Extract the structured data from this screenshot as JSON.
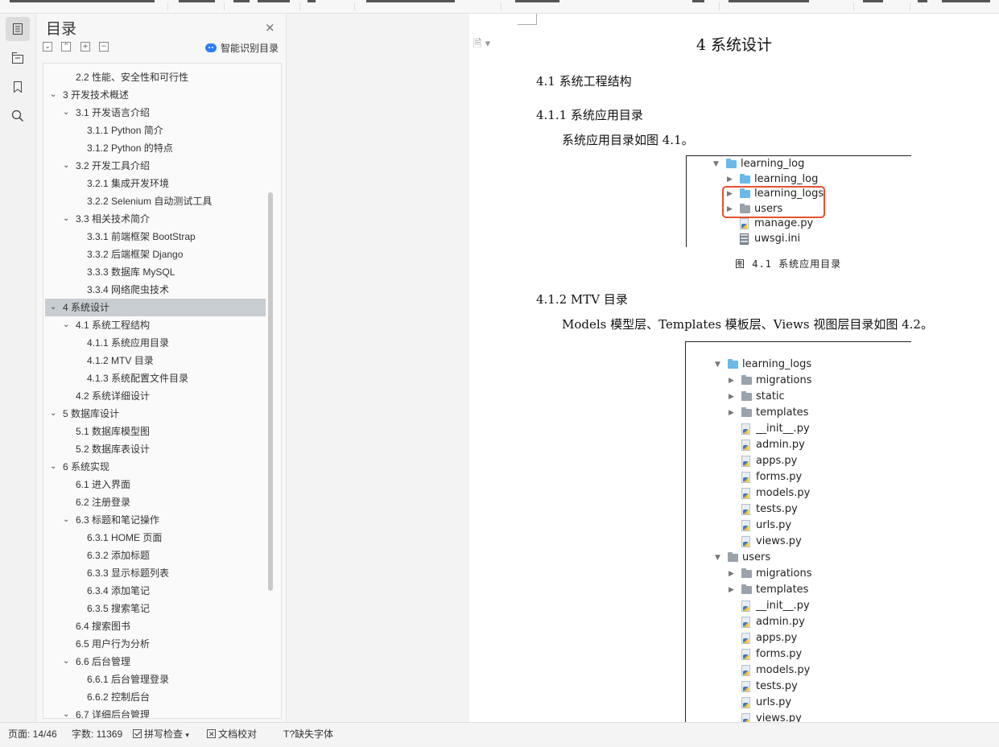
{
  "sidebar_rail": {
    "icons": [
      "toc-icon",
      "nav-pane-icon",
      "bookmark-icon",
      "search-icon"
    ]
  },
  "toc": {
    "title": "目录",
    "close_glyph": "×",
    "tools": [
      "⌄",
      "⌃",
      "+",
      "−"
    ],
    "smart_label": "智能识别目录",
    "items": [
      {
        "label": "2.2  性能、安全性和可行性",
        "level": 2,
        "expand": ""
      },
      {
        "label": "3 开发技术概述",
        "level": 1,
        "expand": "⌄"
      },
      {
        "label": "3.1  开发语言介绍",
        "level": 2,
        "expand": "⌄"
      },
      {
        "label": "3.1.1 Python 简介",
        "level": 3,
        "expand": ""
      },
      {
        "label": "3.1.2 Python 的特点",
        "level": 3,
        "expand": ""
      },
      {
        "label": "3.2  开发工具介绍",
        "level": 2,
        "expand": "⌄"
      },
      {
        "label": "3.2.1  集成开发环境",
        "level": 3,
        "expand": ""
      },
      {
        "label": "3.2.2 Selenium 自动测试工具",
        "level": 3,
        "expand": ""
      },
      {
        "label": "3.3  相关技术简介",
        "level": 2,
        "expand": "⌄"
      },
      {
        "label": "3.3.1  前端框架 BootStrap",
        "level": 3,
        "expand": ""
      },
      {
        "label": "3.3.2  后端框架 Django",
        "level": 3,
        "expand": ""
      },
      {
        "label": "3.3.3  数据库 MySQL",
        "level": 3,
        "expand": ""
      },
      {
        "label": "3.3.4  网络爬虫技术",
        "level": 3,
        "expand": ""
      },
      {
        "label": "4 系统设计",
        "level": 1,
        "expand": "⌄",
        "selected": true
      },
      {
        "label": "4.1  系统工程结构",
        "level": 2,
        "expand": "⌄"
      },
      {
        "label": "4.1.1  系统应用目录",
        "level": 3,
        "expand": ""
      },
      {
        "label": "4.1.2 MTV 目录",
        "level": 3,
        "expand": ""
      },
      {
        "label": "4.1.3  系统配置文件目录",
        "level": 3,
        "expand": ""
      },
      {
        "label": "4.2  系统详细设计",
        "level": 2,
        "expand": ""
      },
      {
        "label": "5 数据库设计",
        "level": 1,
        "expand": "⌄"
      },
      {
        "label": "5.1  数据库模型图",
        "level": 2,
        "expand": ""
      },
      {
        "label": "5.2  数据库表设计",
        "level": 2,
        "expand": ""
      },
      {
        "label": "6 系统实现",
        "level": 1,
        "expand": "⌄"
      },
      {
        "label": "6.1 进入界面",
        "level": 2,
        "expand": ""
      },
      {
        "label": "6.2 注册登录",
        "level": 2,
        "expand": ""
      },
      {
        "label": "6.3  标题和笔记操作",
        "level": 2,
        "expand": "⌄"
      },
      {
        "label": "6.3.1 HOME 页面",
        "level": 3,
        "expand": ""
      },
      {
        "label": "6.3.2  添加标题",
        "level": 3,
        "expand": ""
      },
      {
        "label": "6.3.3  显示标题列表",
        "level": 3,
        "expand": ""
      },
      {
        "label": "6.3.4  添加笔记",
        "level": 3,
        "expand": ""
      },
      {
        "label": "6.3.5  搜索笔记",
        "level": 3,
        "expand": ""
      },
      {
        "label": "6.4  搜索图书",
        "level": 2,
        "expand": ""
      },
      {
        "label": "6.5  用户行为分析",
        "level": 2,
        "expand": ""
      },
      {
        "label": "6.6  后台管理",
        "level": 2,
        "expand": "⌄"
      },
      {
        "label": "6.6.1 后台管理登录",
        "level": 3,
        "expand": ""
      },
      {
        "label": "6.6.2  控制后台",
        "level": 3,
        "expand": ""
      },
      {
        "label": "6.7  详细后台管理",
        "level": 2,
        "expand": "⌄"
      }
    ]
  },
  "document": {
    "side_glyph": "🗎 ▾",
    "chapter_title": "4 系统设计",
    "h_4_1": "4.1  系统工程结构",
    "h_4_1_1": "4.1.1  系统应用目录",
    "p_4_1_1": "系统应用目录如图 4.1。",
    "caption_4_1": "图 4.1 系统应用目录",
    "h_4_1_2": "4.1.2 MTV 目录",
    "p_4_1_2": "Models 模型层、Templates 模板层、Views 视图层目录如图 4.2。",
    "figure_4_1": [
      {
        "name": "learning_log",
        "type": "folder-blue",
        "indent": 0,
        "arrow": "▼"
      },
      {
        "name": "learning_log",
        "type": "folder-blue",
        "indent": 1,
        "arrow": "▶"
      },
      {
        "name": "learning_logs",
        "type": "folder-blue",
        "indent": 1,
        "arrow": "▶"
      },
      {
        "name": "users",
        "type": "folder-gray",
        "indent": 1,
        "arrow": "▶"
      },
      {
        "name": "manage.py",
        "type": "py",
        "indent": 1,
        "arrow": ""
      },
      {
        "name": "uwsgi.ini",
        "type": "ini",
        "indent": 1,
        "arrow": ""
      }
    ],
    "figure_4_2": [
      {
        "name": "learning_logs",
        "type": "folder-blue",
        "indent": 0,
        "arrow": "▼"
      },
      {
        "name": "migrations",
        "type": "folder-gray",
        "indent": 1,
        "arrow": "▶"
      },
      {
        "name": "static",
        "type": "folder-gray",
        "indent": 1,
        "arrow": "▶"
      },
      {
        "name": "templates",
        "type": "folder-gray",
        "indent": 1,
        "arrow": "▶"
      },
      {
        "name": "__init__.py",
        "type": "py",
        "indent": 1,
        "arrow": ""
      },
      {
        "name": "admin.py",
        "type": "py",
        "indent": 1,
        "arrow": ""
      },
      {
        "name": "apps.py",
        "type": "py",
        "indent": 1,
        "arrow": ""
      },
      {
        "name": "forms.py",
        "type": "py",
        "indent": 1,
        "arrow": ""
      },
      {
        "name": "models.py",
        "type": "py",
        "indent": 1,
        "arrow": ""
      },
      {
        "name": "tests.py",
        "type": "py",
        "indent": 1,
        "arrow": ""
      },
      {
        "name": "urls.py",
        "type": "py",
        "indent": 1,
        "arrow": ""
      },
      {
        "name": "views.py",
        "type": "py",
        "indent": 1,
        "arrow": ""
      },
      {
        "name": "users",
        "type": "folder-gray",
        "indent": 0,
        "arrow": "▼"
      },
      {
        "name": "migrations",
        "type": "folder-gray",
        "indent": 1,
        "arrow": "▶"
      },
      {
        "name": "templates",
        "type": "folder-gray",
        "indent": 1,
        "arrow": "▶"
      },
      {
        "name": "__init__.py",
        "type": "py",
        "indent": 1,
        "arrow": ""
      },
      {
        "name": "admin.py",
        "type": "py",
        "indent": 1,
        "arrow": ""
      },
      {
        "name": "apps.py",
        "type": "py",
        "indent": 1,
        "arrow": ""
      },
      {
        "name": "forms.py",
        "type": "py",
        "indent": 1,
        "arrow": ""
      },
      {
        "name": "models.py",
        "type": "py",
        "indent": 1,
        "arrow": ""
      },
      {
        "name": "tests.py",
        "type": "py",
        "indent": 1,
        "arrow": ""
      },
      {
        "name": "urls.py",
        "type": "py",
        "indent": 1,
        "arrow": ""
      },
      {
        "name": "views.py",
        "type": "py",
        "indent": 1,
        "arrow": ""
      }
    ]
  },
  "status_bar": {
    "page": "页面: 14/46",
    "words": "字数: 11369",
    "spell": "拼写检查",
    "spell_arrow": "▾",
    "proof": "文档校对",
    "font_icon": "T?",
    "missing_font": "缺失字体"
  },
  "colors": {
    "selected_row": "#c8cdd2",
    "highlight_box": "#e4522e",
    "folder_blue": "#6bb9e8",
    "robot_blue": "#2f7ef6"
  }
}
